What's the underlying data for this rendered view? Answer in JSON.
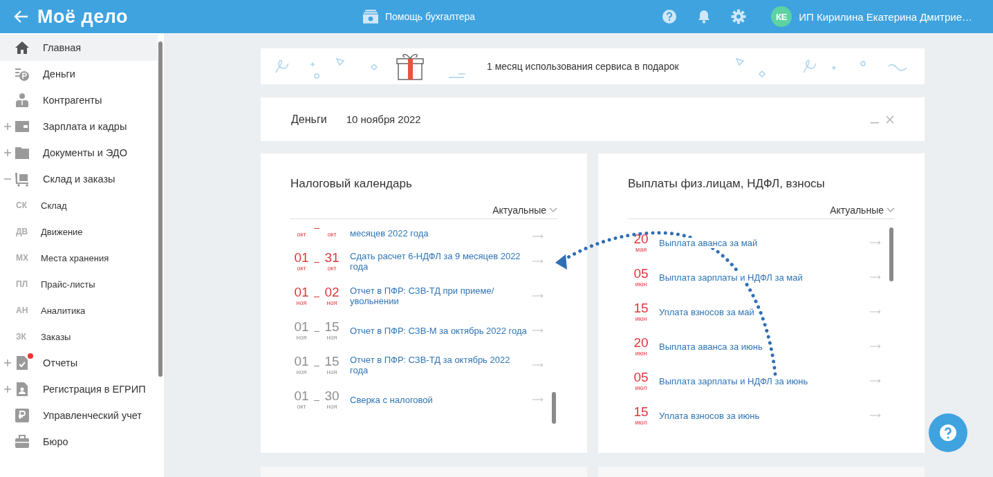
{
  "header": {
    "logo": "Моё дело",
    "help_link": "Помощь бухгалтера",
    "user": {
      "initials": "КЕ",
      "name": "ИП Кирилина Екатерина Дмитрие…"
    }
  },
  "sidebar": {
    "items": [
      {
        "kind": "main",
        "label": "Главная",
        "selected": true,
        "badge": false
      },
      {
        "kind": "main",
        "label": "Деньги",
        "selected": false,
        "badge": false
      },
      {
        "kind": "main",
        "label": "Контрагенты",
        "selected": false,
        "badge": false
      },
      {
        "kind": "main",
        "label": "Зарплата и кадры",
        "selected": false,
        "badge": false,
        "expanded": false
      },
      {
        "kind": "main",
        "label": "Документы и ЭДО",
        "selected": false,
        "badge": false,
        "expanded": false
      },
      {
        "kind": "main",
        "label": "Склад и заказы",
        "selected": false,
        "badge": false,
        "expanded": true
      },
      {
        "kind": "sub",
        "code": "СК",
        "label": "Склад",
        "selected": false
      },
      {
        "kind": "sub",
        "code": "ДВ",
        "label": "Движение",
        "selected": false
      },
      {
        "kind": "sub",
        "code": "МХ",
        "label": "Места хранения",
        "selected": false
      },
      {
        "kind": "sub",
        "code": "ПЛ",
        "label": "Прайс-листы",
        "selected": false
      },
      {
        "kind": "sub",
        "code": "АН",
        "label": "Аналитика",
        "selected": false
      },
      {
        "kind": "sub",
        "code": "ЗК",
        "label": "Заказы",
        "selected": false
      },
      {
        "kind": "main",
        "label": "Отчеты",
        "selected": false,
        "badge": true,
        "expanded": false
      },
      {
        "kind": "main",
        "label": "Регистрация в ЕГРИП",
        "selected": false,
        "badge": false,
        "expanded": false
      },
      {
        "kind": "main",
        "label": "Управленческий учет",
        "selected": false,
        "badge": false
      },
      {
        "kind": "main",
        "label": "Бюро",
        "selected": false,
        "badge": false
      }
    ]
  },
  "banner": {
    "text": "1 месяц использования сервиса в подарок"
  },
  "money": {
    "title": "Деньги",
    "date": "10 ноября 2022"
  },
  "tax_calendar": {
    "title": "Налоговый календарь",
    "filter": "Актуальные",
    "rows": [
      {
        "from": {
          "month": "окт"
        },
        "to": {
          "month": "окт"
        },
        "title": "месяцев 2022 года",
        "overdue": true
      },
      {
        "from": {
          "day": "01",
          "month": "окт"
        },
        "to": {
          "day": "31",
          "month": "окт"
        },
        "title": "Сдать расчет 6-НДФЛ за 9 месяцев 2022 года",
        "overdue": true
      },
      {
        "from": {
          "day": "01",
          "month": "ноя"
        },
        "to": {
          "day": "02",
          "month": "ноя"
        },
        "title": "Отчет в ПФР: СЗВ-ТД при приеме/увольнении",
        "overdue": true
      },
      {
        "from": {
          "day": "01",
          "month": "ноя"
        },
        "to": {
          "day": "15",
          "month": "ноя"
        },
        "title": "Отчет в ПФР: СЗВ-М за октябрь 2022 года",
        "overdue": false
      },
      {
        "from": {
          "day": "01",
          "month": "ноя"
        },
        "to": {
          "day": "15",
          "month": "ноя"
        },
        "title": "Отчет в ПФР: СЗВ-ТД за октябрь 2022 года",
        "overdue": false
      },
      {
        "from": {
          "day": "01",
          "month": "окт"
        },
        "to": {
          "day": "30",
          "month": "ноя"
        },
        "title": "Сверка с налоговой",
        "overdue": false
      }
    ]
  },
  "payments": {
    "title": "Выплаты физ.лицам, НДФЛ, взносы",
    "filter": "Актуальные",
    "rows": [
      {
        "day": "20",
        "month": "мая",
        "title": "Выплата аванса за май",
        "overdue": true
      },
      {
        "day": "05",
        "month": "июн",
        "title": "Выплата зарплаты и НДФЛ за май",
        "overdue": true
      },
      {
        "day": "15",
        "month": "июн",
        "title": "Уплата взносов за май",
        "overdue": true
      },
      {
        "day": "20",
        "month": "июн",
        "title": "Выплата аванса за июнь",
        "overdue": true
      },
      {
        "day": "05",
        "month": "июл",
        "title": "Выплата зарплаты и НДФЛ за июнь",
        "overdue": true
      },
      {
        "day": "15",
        "month": "июл",
        "title": "Уплата взносов за июнь",
        "overdue": true
      }
    ]
  }
}
